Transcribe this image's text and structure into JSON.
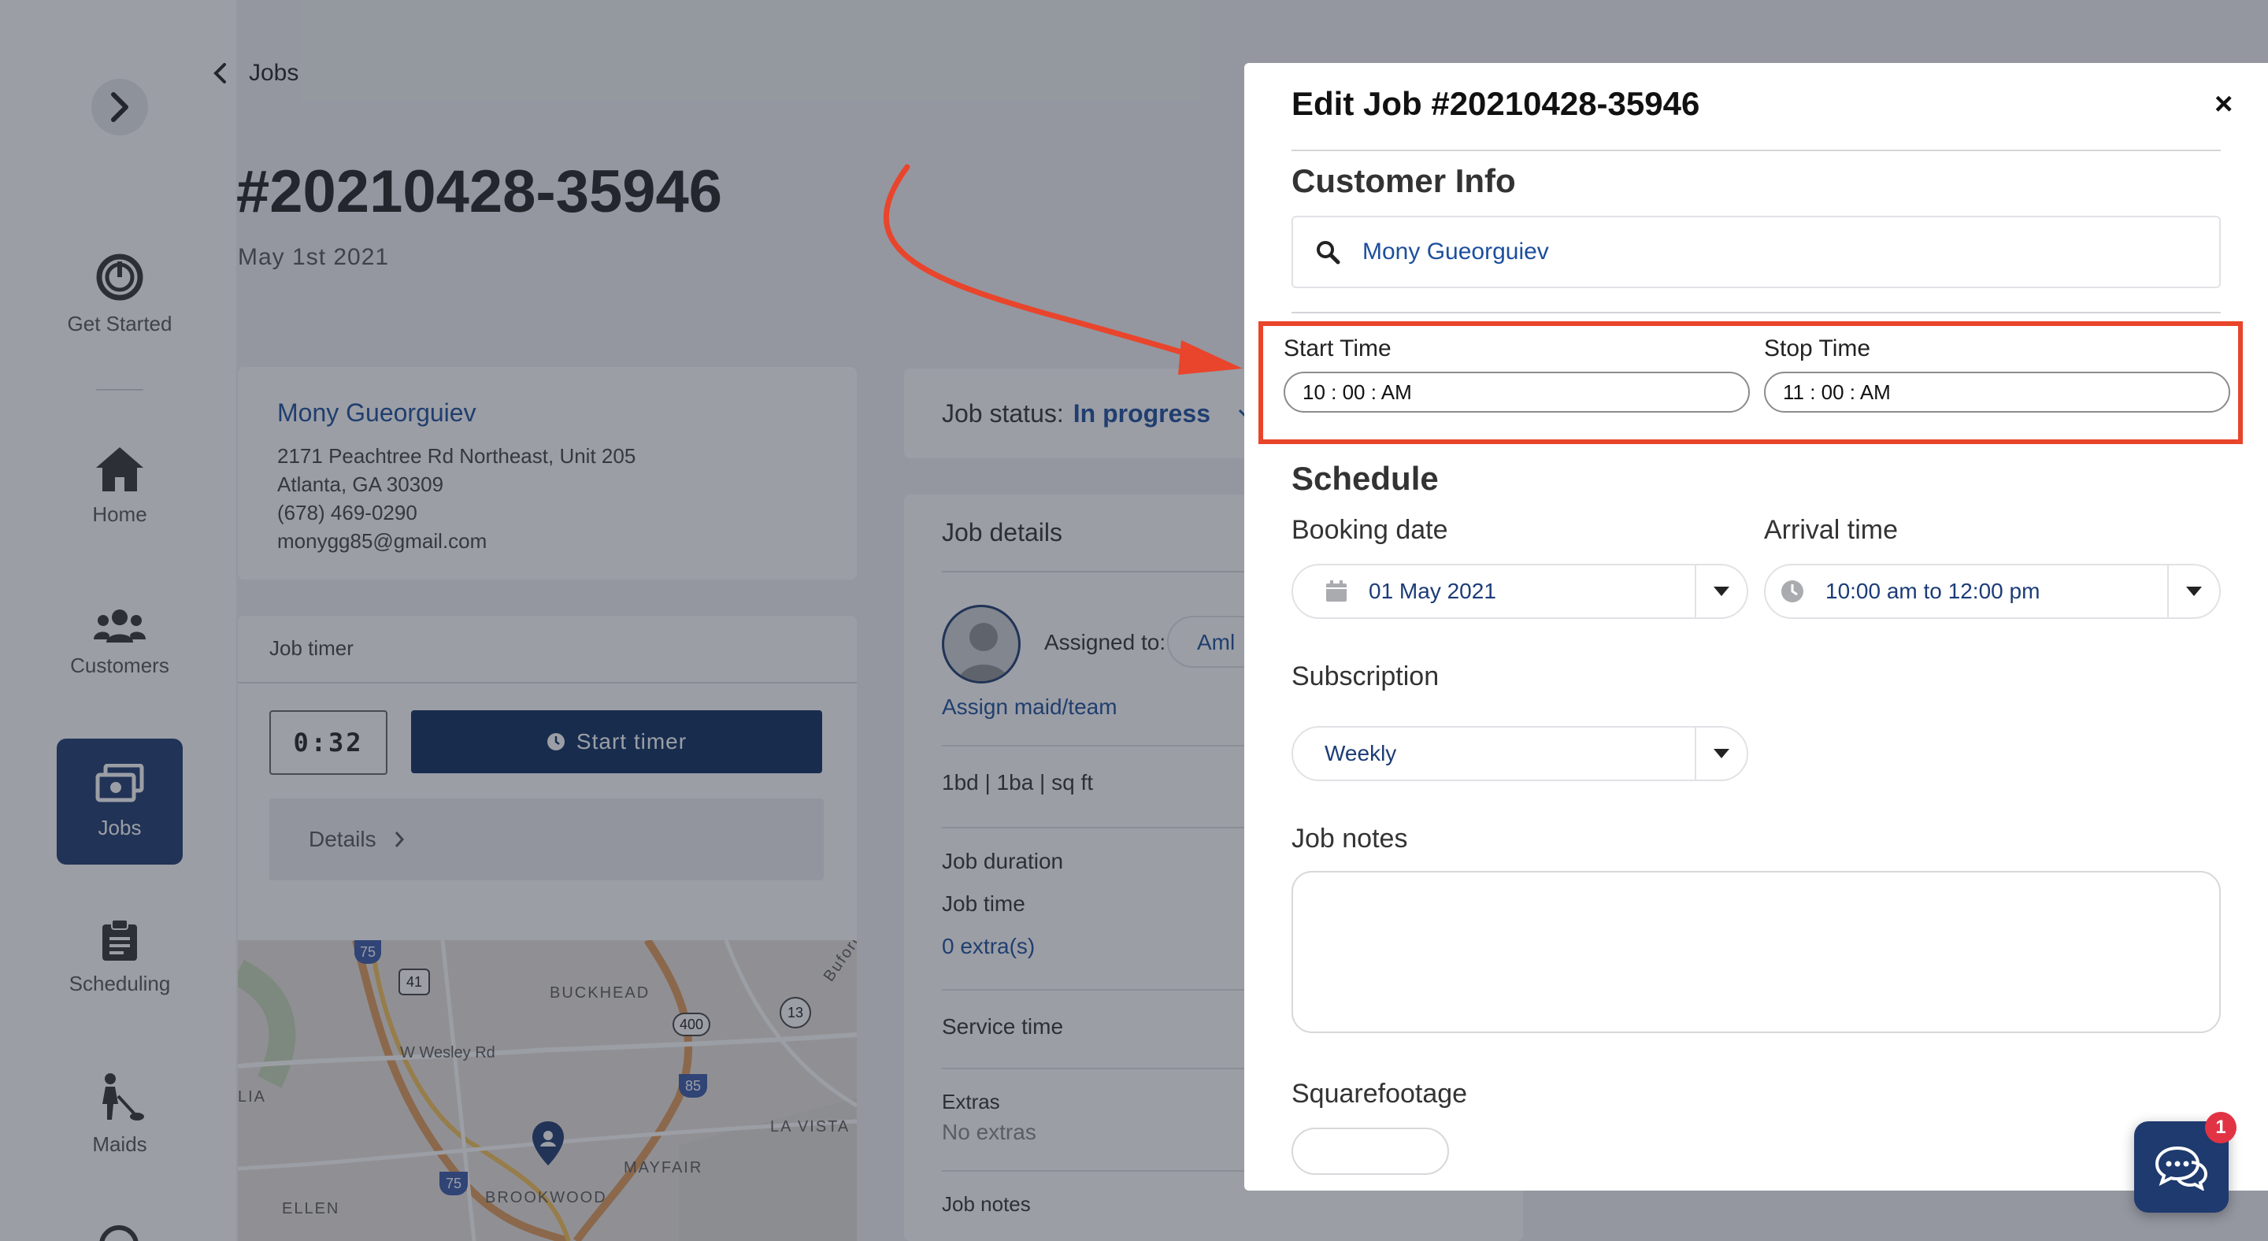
{
  "sidebar": {
    "items": [
      {
        "label": "Get Started",
        "icon": "power-icon"
      },
      {
        "label": "Home",
        "icon": "home-icon"
      },
      {
        "label": "Customers",
        "icon": "users-icon"
      },
      {
        "label": "Jobs",
        "icon": "jobs-icon",
        "active": true
      },
      {
        "label": "Scheduling",
        "icon": "clipboard-icon"
      },
      {
        "label": "Maids",
        "icon": "maid-icon"
      }
    ]
  },
  "breadcrumb": {
    "back_label": "Jobs"
  },
  "job": {
    "number": "#20210428-35946",
    "date": "May 1st 2021"
  },
  "customer": {
    "name": "Mony Gueorguiev",
    "address_line1": "2171 Peachtree Rd Northeast, Unit 205",
    "address_line2": "Atlanta, GA 30309",
    "phone": "(678) 469-0290",
    "email": "monygg85@gmail.com"
  },
  "timer": {
    "title": "Job timer",
    "value": "0:32",
    "start_label": "Start timer",
    "details_label": "Details"
  },
  "map": {
    "labels": [
      "BUCKHEAD",
      "W Wesley Rd",
      "LA VISTA",
      "MAYFAIR",
      "BROOKWOOD",
      "ELLEN",
      "LIA",
      "Buford"
    ],
    "shields": [
      "75",
      "41",
      "400",
      "13",
      "85",
      "75"
    ]
  },
  "status": {
    "label": "Job status:",
    "value": "In progress"
  },
  "details": {
    "title": "Job details",
    "assigned_label": "Assigned to:",
    "assigned_value": "Aml",
    "assign_link": "Assign maid/team",
    "rooms": "1bd | 1ba | sq ft",
    "duration_label": "Job duration",
    "time_label": "Job time",
    "extras_link": "0 extra(s)",
    "service_time_label": "Service time",
    "extras_label": "Extras",
    "extras_value": "No extras",
    "notes_label": "Job notes"
  },
  "modal": {
    "title": "Edit Job #20210428-35946",
    "close": "×",
    "customer_info_heading": "Customer Info",
    "customer_search_value": "Mony Gueorguiev",
    "start_time_label": "Start Time",
    "start_time_value": "10 : 00 : AM",
    "stop_time_label": "Stop Time",
    "stop_time_value": "11 : 00 : AM",
    "schedule_heading": "Schedule",
    "booking_date_label": "Booking date",
    "booking_date_value": "01 May 2021",
    "arrival_time_label": "Arrival time",
    "arrival_time_value": "10:00 am to 12:00 pm",
    "subscription_label": "Subscription",
    "subscription_value": "Weekly",
    "job_notes_label": "Job notes",
    "squarefootage_label": "Squarefootage"
  },
  "chat": {
    "badge": "1"
  },
  "colors": {
    "accent": "#1c4f9c",
    "navy": "#0e2e5e",
    "highlight": "#e8452c",
    "badge": "#e23345"
  }
}
